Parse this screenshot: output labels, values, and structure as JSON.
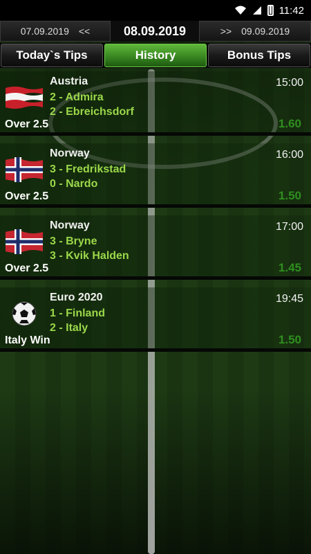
{
  "status_bar": {
    "time": "11:42",
    "icons": [
      "wifi-icon",
      "signal-icon",
      "battery-icon"
    ]
  },
  "date_bar": {
    "prev_date": "07.09.2019",
    "prev_arrow": "<<",
    "current_date": "08.09.2019",
    "next_arrow": ">>",
    "next_date": "09.09.2019"
  },
  "tabs": [
    {
      "label": "Today`s Tips",
      "active": false
    },
    {
      "label": "History",
      "active": true
    },
    {
      "label": "Bonus Tips",
      "active": false
    }
  ],
  "matches": [
    {
      "league": "Austria",
      "team1": "2 - Admira",
      "team2": "2 - Ebreichsdorf",
      "time": "15:00",
      "tip": "Over 2.5",
      "odds": "1.60",
      "icon": "austria-flag-icon"
    },
    {
      "league": "Norway",
      "team1": "3 - Fredrikstad",
      "team2": "0 - Nardo",
      "time": "16:00",
      "tip": "Over 2.5",
      "odds": "1.50",
      "icon": "norway-flag-icon"
    },
    {
      "league": "Norway",
      "team1": "3 - Bryne",
      "team2": "3 - Kvik Halden",
      "time": "17:00",
      "tip": "Over 2.5",
      "odds": "1.45",
      "icon": "norway-flag-icon"
    },
    {
      "league": "Euro 2020",
      "team1": "1 - Finland",
      "team2": "2 - Italy",
      "time": "19:45",
      "tip": "Italy Win",
      "odds": "1.50",
      "icon": "soccer-ball-icon"
    }
  ],
  "colors": {
    "accent": "#4a9e2c",
    "team_text": "#9bd84a",
    "odds_text": "#2f8f1f"
  }
}
